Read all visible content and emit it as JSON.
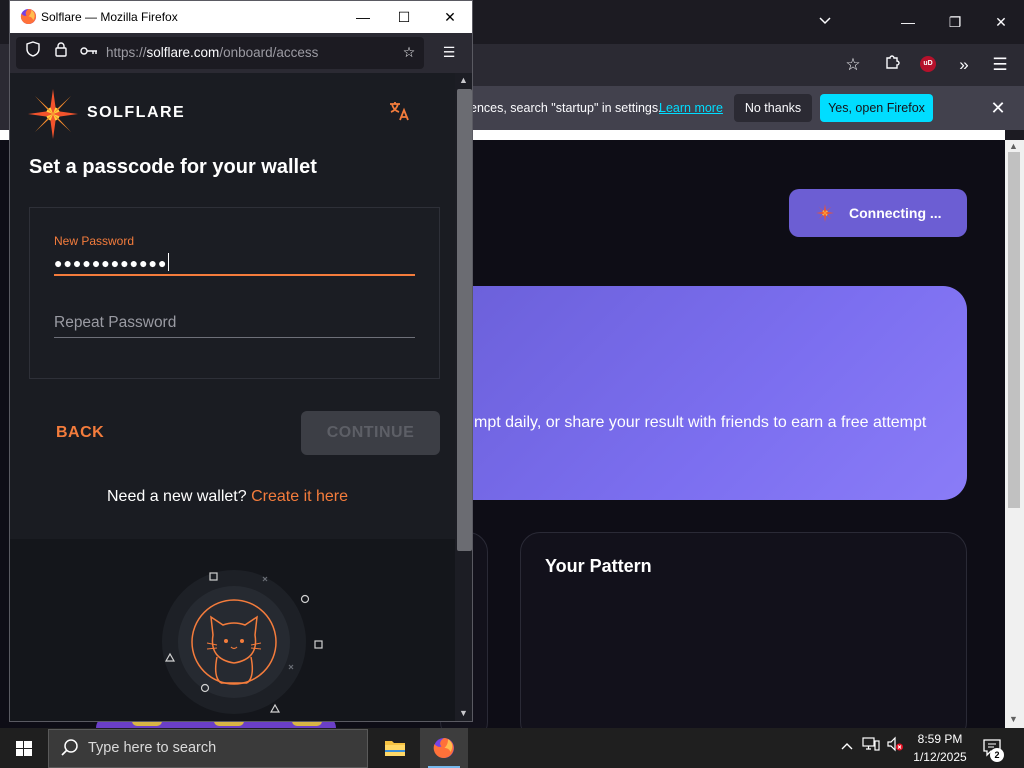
{
  "popup_window": {
    "title": "Solflare — Mozilla Firefox",
    "url_host": "https://solflare.com",
    "url_path": "/onboard/access"
  },
  "solflare": {
    "brand": "SOLFLARE",
    "heading": "Set a passcode for your wallet",
    "new_password_label": "New Password",
    "new_password_value": "●●●●●●●●●●●●",
    "repeat_password_placeholder": "Repeat Password",
    "back_label": "BACK",
    "continue_label": "CONTINUE",
    "new_wallet_prompt": "Need a new wallet?",
    "create_link": "Create it here",
    "translate_icon": "translate-icon",
    "accent_color": "#f47c3c"
  },
  "background_window": {
    "notification_text": "ences, search \"startup\" in settings.",
    "learn_more": "Learn more",
    "no_thanks": "No thanks",
    "yes_open": "Yes, open Firefox",
    "connecting_label": "Connecting ...",
    "banner_text": "mpt daily, or share your result with friends to earn a free attempt",
    "pattern_title": "Your Pattern",
    "accent_color": "#6c5ed3"
  },
  "taskbar": {
    "search_placeholder": "Type here to search",
    "time": "8:59 PM",
    "date": "1/12/2025",
    "notification_count": "2"
  }
}
